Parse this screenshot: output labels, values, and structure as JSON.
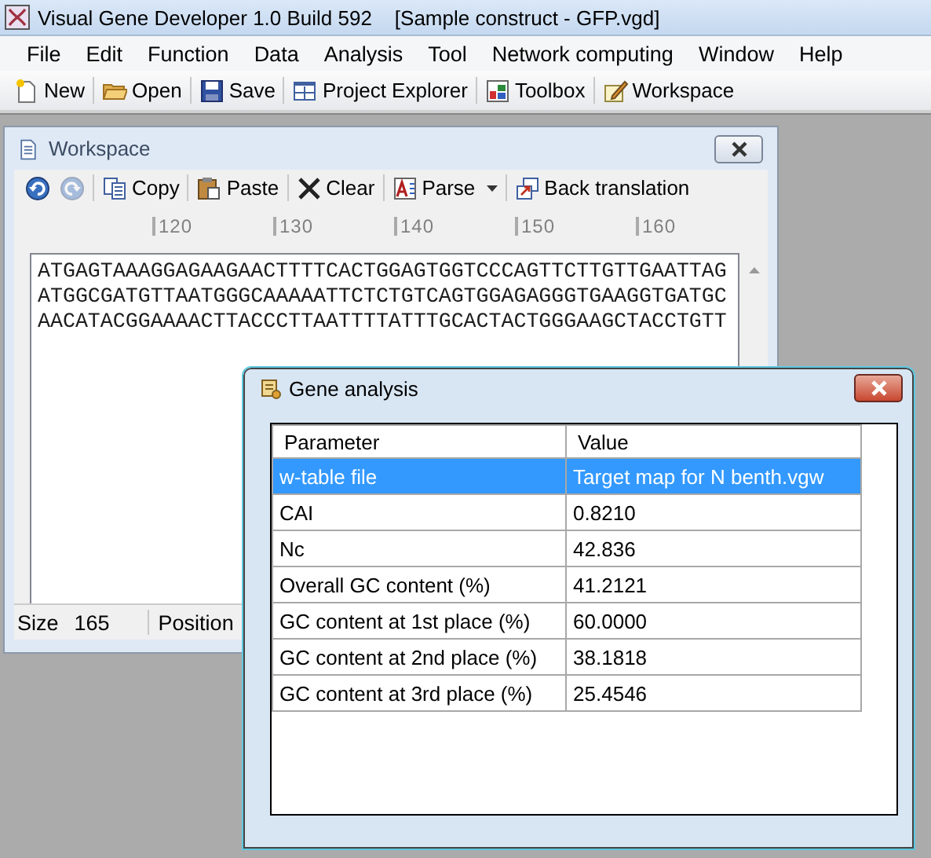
{
  "window": {
    "title": "Visual Gene Developer 1.0 Build 592    [Sample construct - GFP.vgd]"
  },
  "menu": [
    "File",
    "Edit",
    "Function",
    "Data",
    "Analysis",
    "Tool",
    "Network computing",
    "Window",
    "Help"
  ],
  "toolbar": [
    {
      "label": "New"
    },
    {
      "label": "Open"
    },
    {
      "label": "Save"
    },
    {
      "label": "Project Explorer"
    },
    {
      "label": "Toolbox"
    },
    {
      "label": "Workspace"
    }
  ],
  "workspace": {
    "title": "Workspace",
    "toolbar": [
      {
        "disabled": false,
        "dropdown": false
      },
      {
        "disabled": true,
        "dropdown": false
      },
      {
        "label": "Copy",
        "disabled": false,
        "dropdown": false
      },
      {
        "label": "Paste",
        "disabled": false,
        "dropdown": false
      },
      {
        "label": "Clear",
        "disabled": false,
        "dropdown": false
      },
      {
        "label": "Parse",
        "disabled": false,
        "dropdown": true
      },
      {
        "label": "Back translation",
        "disabled": false,
        "dropdown": false
      }
    ],
    "ruler": [
      "120",
      "130",
      "140",
      "150",
      "160"
    ],
    "sequence": [
      "ATGAGTAAAGGAGAAGAACTTTTCACTGGAGTGGTCCCAGTTCTTGTTGAATTAG",
      "ATGGCGATGTTAATGGGCAAAAATTCTCTGTCAGTGGAGAGGGTGAAGGTGATGC",
      "AACATACGGAAAACTTACCCTTAATTTTATTTGCACTACTGGGAAGCTACCTGTT"
    ],
    "status": {
      "size_label": "Size",
      "size_value": "165",
      "position_label": "Position"
    }
  },
  "dialog": {
    "title": "Gene analysis",
    "columns": [
      "Parameter",
      "Value"
    ],
    "rows": [
      {
        "cells": [
          "w-table file",
          "Target map for N benth.vgw"
        ],
        "selected": true
      },
      {
        "cells": [
          "CAI",
          "0.8210"
        ],
        "selected": false
      },
      {
        "cells": [
          "Nc",
          "42.836"
        ],
        "selected": false
      },
      {
        "cells": [
          "Overall GC content (%)",
          "41.2121"
        ],
        "selected": false
      },
      {
        "cells": [
          "GC content at 1st place (%)",
          "60.0000"
        ],
        "selected": false
      },
      {
        "cells": [
          "GC content at 2nd place (%)",
          "38.1818"
        ],
        "selected": false
      },
      {
        "cells": [
          "GC content at 3rd place (%)",
          "25.4546"
        ],
        "selected": false
      }
    ]
  }
}
